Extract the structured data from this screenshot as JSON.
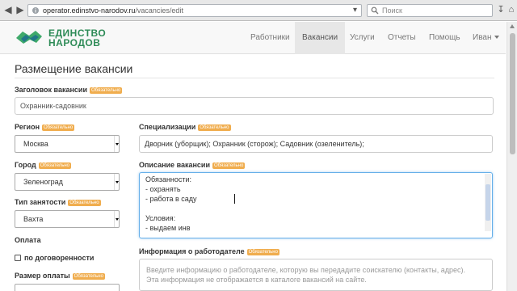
{
  "browser": {
    "url_host": "operator.edinstvo-narodov.ru",
    "url_path": "/vacancies/edit",
    "search_placeholder": "Поиск"
  },
  "site": {
    "logo_line1": "ЕДИНСТВО",
    "logo_line2": "НАРОДОВ",
    "nav": [
      "Работники",
      "Вакансии",
      "Услуги",
      "Отчеты",
      "Помощь"
    ],
    "user_name": "Иван",
    "active_nav": "Вакансии",
    "brand_color": "#2e8b57"
  },
  "form": {
    "title": "Размещение вакансии",
    "required_badge": "Обязательно",
    "vacancy_title_label": "Заголовок вакансии",
    "vacancy_title_value": "Охранник-садовник",
    "region_label": "Регион",
    "region_value": "Москва",
    "city_label": "Город",
    "city_value": "Зеленоград",
    "employment_label": "Тип занятости",
    "employment_value": "Вахта",
    "pay_label": "Оплата",
    "pay_negotiable_label": "по договоренности",
    "pay_negotiable_checked": false,
    "pay_size_label": "Размер оплаты",
    "specializations_label": "Специализации",
    "specializations_value": "Дворник (уборщик); Охранник (сторож); Садовник (озеленитель);",
    "description_label": "Описание вакансии",
    "description_lines": [
      "Обязанности:",
      "- охранять",
      "- работа в саду",
      "",
      "Условия:",
      "- выдаем инв"
    ],
    "employer_info_label": "Информация о работодателе",
    "employer_info_placeholder_1": "Введите информацию о работодателе, которую вы передадите соискателю (контакты, адрес).",
    "employer_info_placeholder_2": "Эта информация не отображается в каталоге вакансий на сайте."
  }
}
